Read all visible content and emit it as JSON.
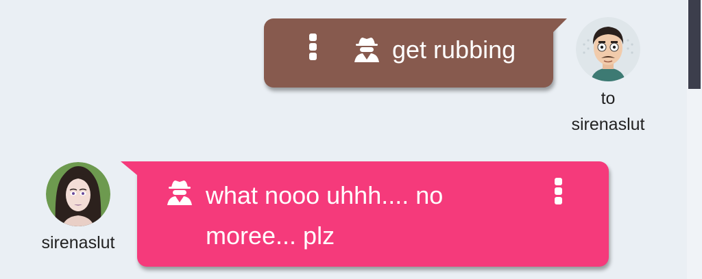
{
  "messages": [
    {
      "direction": "outgoing",
      "text": "get rubbing",
      "color": "#875a4e",
      "avatar_label": "to\nsirenaslut",
      "icons": [
        "more-vert-icon",
        "spy-icon"
      ]
    },
    {
      "direction": "incoming",
      "text": "what nooo uhhh.... no\nmoree... plz",
      "color": "#f53a7b",
      "avatar_label": "sirenaslut",
      "icons": [
        "spy-icon",
        "more-vert-icon"
      ]
    }
  ],
  "theme": {
    "background": "#eaeff4",
    "scrollbar_thumb": "#3c3e4c"
  }
}
